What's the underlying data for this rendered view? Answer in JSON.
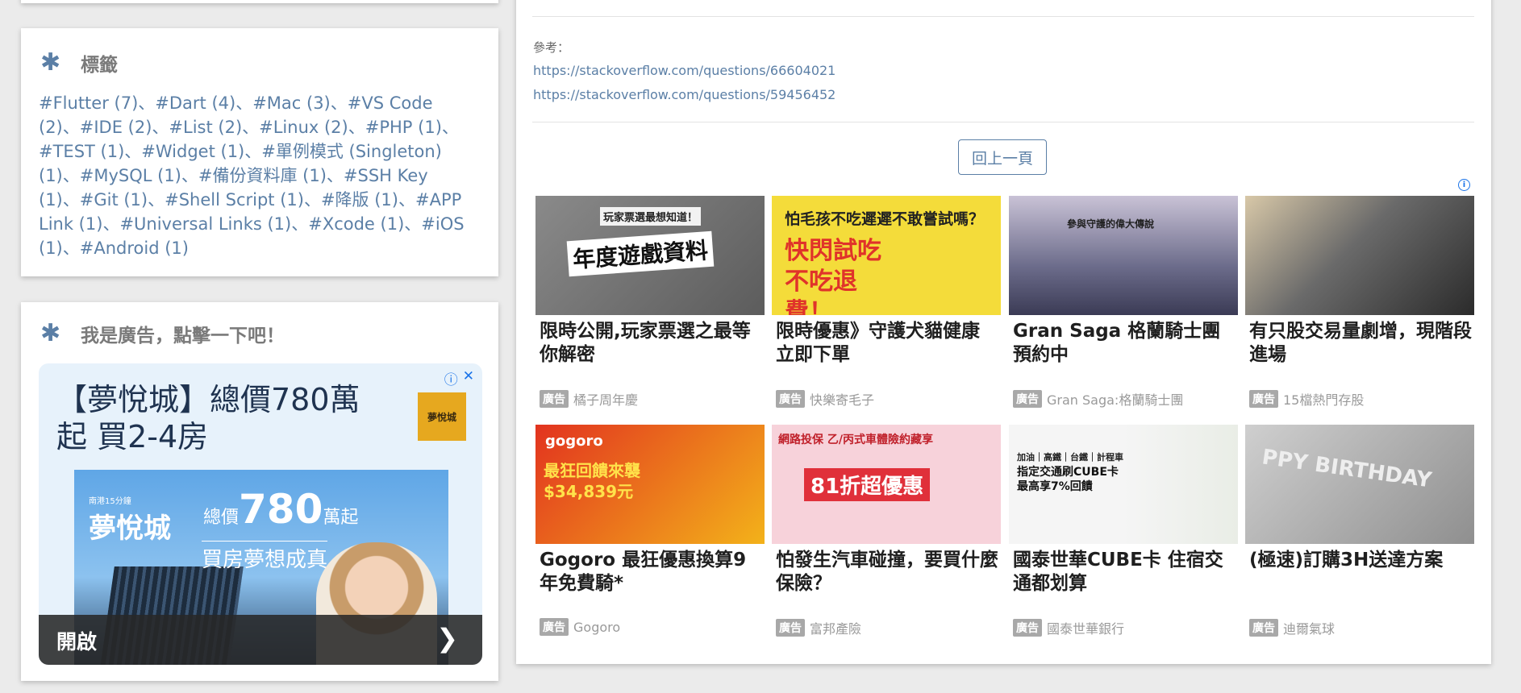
{
  "tags_widget": {
    "title": "標籤",
    "tags": [
      "#Flutter (7)",
      "#Dart (4)",
      "#Mac (3)",
      "#VS Code (2)",
      "#IDE (2)",
      "#List (2)",
      "#Linux (2)",
      "#PHP (1)",
      "#TEST (1)",
      "#Widget (1)",
      "#單例模式 (Singleton) (1)",
      "#MySQL (1)",
      "#備份資料庫 (1)",
      "#SSH Key (1)",
      "#Git (1)",
      "#Shell Script (1)",
      "#降版 (1)",
      "#APP Link (1)",
      "#Universal Links (1)",
      "#Xcode (1)",
      "#iOS (1)",
      "#Android (1)"
    ],
    "separator": "、"
  },
  "ad_widget": {
    "title": "我是廣告，點擊一下吧！",
    "headline": "【夢悅城】總價780萬起 買2-4房",
    "logo_text": "夢悅城",
    "image_brand_small": "南港15分鐘",
    "image_brand": "夢悅城",
    "image_price_prefix": "總價",
    "image_price_num": "780",
    "image_price_suffix": "萬起",
    "image_slogan": "買房夢想成真",
    "cta": "開啟",
    "choices_icons": [
      "info-icon",
      "close-icon"
    ]
  },
  "article": {
    "ref_label": "參考：",
    "links": [
      "https://stackoverflow.com/questions/66604021",
      "https://stackoverflow.com/questions/59456452"
    ],
    "back_button": "回上一頁"
  },
  "ad_grid": {
    "badge": "廣告",
    "items": [
      {
        "title": "限時公開,玩家票選之最等你解密",
        "source": "橘子周年慶",
        "thumb_text": "年度遊戲資料",
        "thumb_sub": "玩家票選最想知道！"
      },
      {
        "title": "限時優惠》守護犬貓健康 立即下單",
        "source": "快樂寄毛子",
        "thumb_text": "快閃試吃 不吃退費！",
        "thumb_sub": "怕毛孩不吃遲遲不敢嘗試嗎？"
      },
      {
        "title": "Gran Saga 格蘭騎士團 預約中",
        "source": "Gran Saga:格蘭騎士團",
        "thumb_text": "",
        "thumb_sub": "參與守護的偉大傳說"
      },
      {
        "title": "有只股交易量劇增，現階段進場",
        "source": "15檔熱門存股",
        "thumb_text": "",
        "thumb_sub": ""
      },
      {
        "title": "Gogoro 最狂優惠換算9年免費騎*",
        "source": "Gogoro",
        "thumb_text": "最狂回饋來襲 $34,839元",
        "thumb_sub": "gogoro"
      },
      {
        "title": "怕發生汽車碰撞，要買什麼保險？",
        "source": "富邦產險",
        "thumb_text": "81折超優惠",
        "thumb_sub": "網路投保 乙/丙式車體險約藏享"
      },
      {
        "title": "國泰世華CUBE卡 住宿交通都划算",
        "source": "國泰世華銀行",
        "thumb_text": "指定交通刷CUBE卡 最高享7%回饋",
        "thumb_sub": "加油｜高鐵｜台鐵｜計程車"
      },
      {
        "title": "(極速)訂購3H送達方案",
        "source": "迪爾氣球",
        "thumb_text": "PPY BIRTHDAY",
        "thumb_sub": ""
      }
    ]
  },
  "colors": {
    "accent": "#5b7fa6",
    "background": "#ebebeb"
  }
}
